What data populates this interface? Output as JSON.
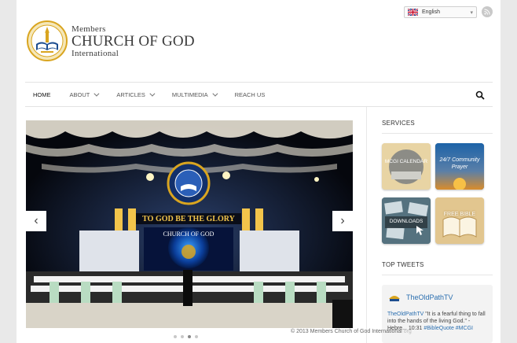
{
  "language": {
    "selected": "English",
    "flag": "uk-flag-icon"
  },
  "logo": {
    "line1": "Members",
    "line2": "CHURCH OF GOD",
    "line3": "International"
  },
  "nav": {
    "items": [
      {
        "label": "HOME"
      },
      {
        "label": "ABOUT"
      },
      {
        "label": "ARTICLES"
      },
      {
        "label": "MULTIMEDIA"
      },
      {
        "label": "REACH US"
      }
    ]
  },
  "slider": {
    "banner_text": "TO GOD BE THE GLORY",
    "screen_text": "CHURCH OF GOD",
    "slides": 4,
    "active_slide": 3
  },
  "sidebar": {
    "services_heading": "SERVICES",
    "services": [
      {
        "label": "MCGI CALENDAR"
      },
      {
        "label": "24/7 Community Prayer"
      },
      {
        "label": "DOWNLOADS"
      },
      {
        "label": "FREE BIBLE"
      }
    ],
    "tweets_heading": "TOP TWEETS",
    "tweet": {
      "user": "TheOldPathTV",
      "text_user": "TheOldPathTV",
      "text": " \"It is a fearful thing to fall into the hands of the living God.\" - Hebre... 10:31 ",
      "tags": "#BibleQuote #MCGI"
    }
  },
  "footer": {
    "copyright": "© 2013  Members Church of God International",
    "tail": "org"
  },
  "colors": {
    "link": "#2b6fb0",
    "logo_gold": "#d9a520",
    "logo_blue": "#1d4d8f"
  }
}
